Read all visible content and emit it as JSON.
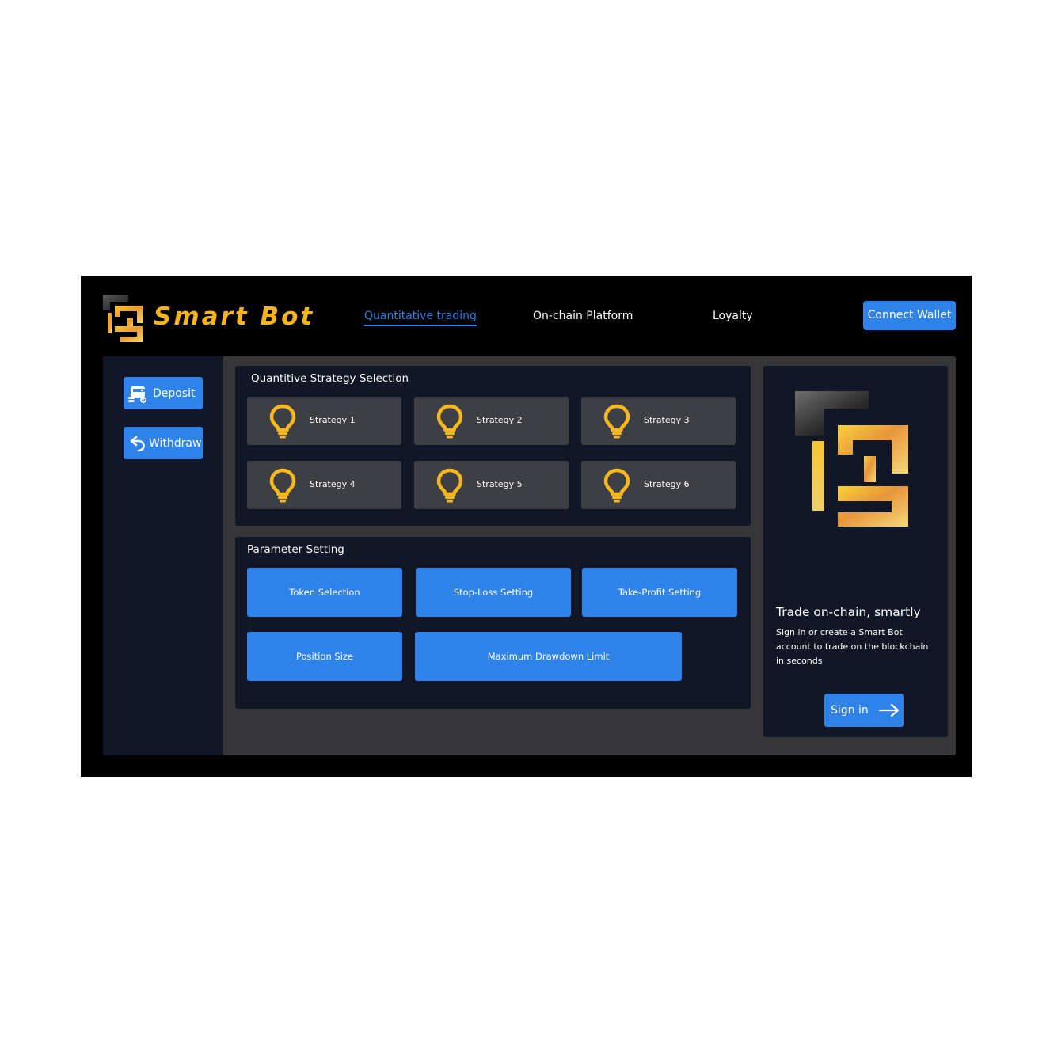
{
  "header": {
    "brand": "Smart Bot",
    "nav": [
      {
        "label": "Quantitative trading",
        "active": true
      },
      {
        "label": "On-chain Platform",
        "active": false
      },
      {
        "label": "Loyalty",
        "active": false
      }
    ],
    "connect_wallet_label": "Connect Wallet"
  },
  "sidebar": {
    "deposit_label": "Deposit",
    "deposit_icon": "wallet-icon",
    "withdraw_label": "Withdraw",
    "withdraw_icon": "undo-arrow-icon"
  },
  "strategy_panel": {
    "title": "Quantitive  Strategy  Selection",
    "icon": "lightbulb-icon",
    "strategies": [
      "Strategy 1",
      "Strategy 2",
      "Strategy 3",
      "Strategy 4",
      "Strategy 5",
      "Strategy 6"
    ]
  },
  "param_panel": {
    "title": "Parameter  Setting",
    "buttons": [
      "Token Selection",
      "Stop-Loss Setting",
      "Take-Profit Setting",
      "Position Size",
      "Maximum Drawdown Limit"
    ]
  },
  "signin_panel": {
    "heading": "Trade on-chain, smartly",
    "text": "Sign in or create a Smart Bot account to trade on the blockchain in  seconds",
    "button_label": "Sign in"
  },
  "colors": {
    "accent": "#2e82e8",
    "brand_gold": "#f7b51c",
    "panel": "#111726",
    "card": "#3d3f44"
  }
}
